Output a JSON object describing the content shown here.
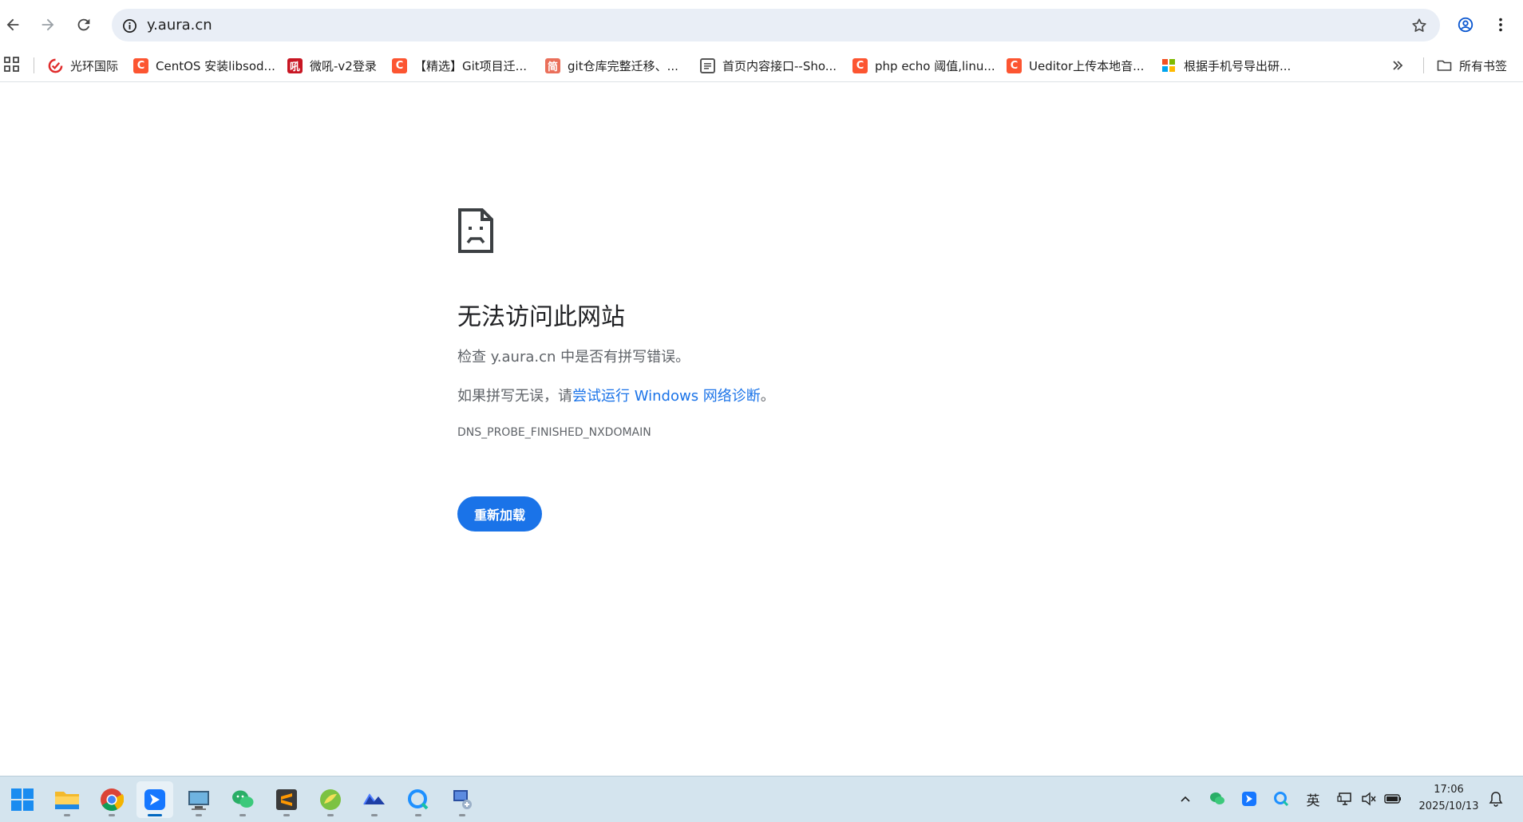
{
  "browser": {
    "url": "y.aura.cn",
    "bookmarks": [
      {
        "label": "光环国际",
        "icon": "guanghuan-logo-icon"
      },
      {
        "label": "CentOS 安装libsod...",
        "icon": "csdn-logo-icon"
      },
      {
        "label": "微吼-v2登录",
        "icon": "vhall-logo-icon"
      },
      {
        "label": "【精选】Git项目迁...",
        "icon": "csdn-logo-icon"
      },
      {
        "label": "git仓库完整迁移、...",
        "icon": "jianshu-logo-icon"
      },
      {
        "label": "首页内容接口--Sho...",
        "icon": "document-icon"
      },
      {
        "label": "php echo 阈值,linu...",
        "icon": "csdn-logo-icon"
      },
      {
        "label": "Ueditor上传本地音...",
        "icon": "csdn-logo-icon"
      },
      {
        "label": "根据手机号导出研...",
        "icon": "colorful-grid-logo-icon"
      }
    ],
    "all_bookmarks_label": "所有书签",
    "csdn_glyph": "C",
    "jianshu_glyph": "简",
    "vhall_glyph": "吼"
  },
  "error": {
    "title": "无法访问此网站",
    "line1": "检查 y.aura.cn 中是否有拼写错误。",
    "line2_prefix": "如果拼写无误，请",
    "line2_link": "尝试运行 Windows 网络诊断",
    "line2_suffix": "。",
    "code": "DNS_PROBE_FINISHED_NXDOMAIN",
    "reload_label": "重新加载"
  },
  "taskbar": {
    "apps": [
      "start-icon",
      "file-explorer-icon",
      "chrome-icon",
      "feishu-icon",
      "remote-desktop-icon",
      "wechat-icon",
      "sublime-text-icon",
      "green-app-icon",
      "mail-app-icon",
      "qq-browser-icon",
      "network-tool-icon"
    ],
    "ime_label": "英",
    "time": "17:06",
    "date": "2025/10/13"
  },
  "colors": {
    "accent": "#1a73e8",
    "omnibox_bg": "#e9eef6",
    "taskbar_bg": "#d4e4ee",
    "csdn_red": "#fc5531"
  }
}
